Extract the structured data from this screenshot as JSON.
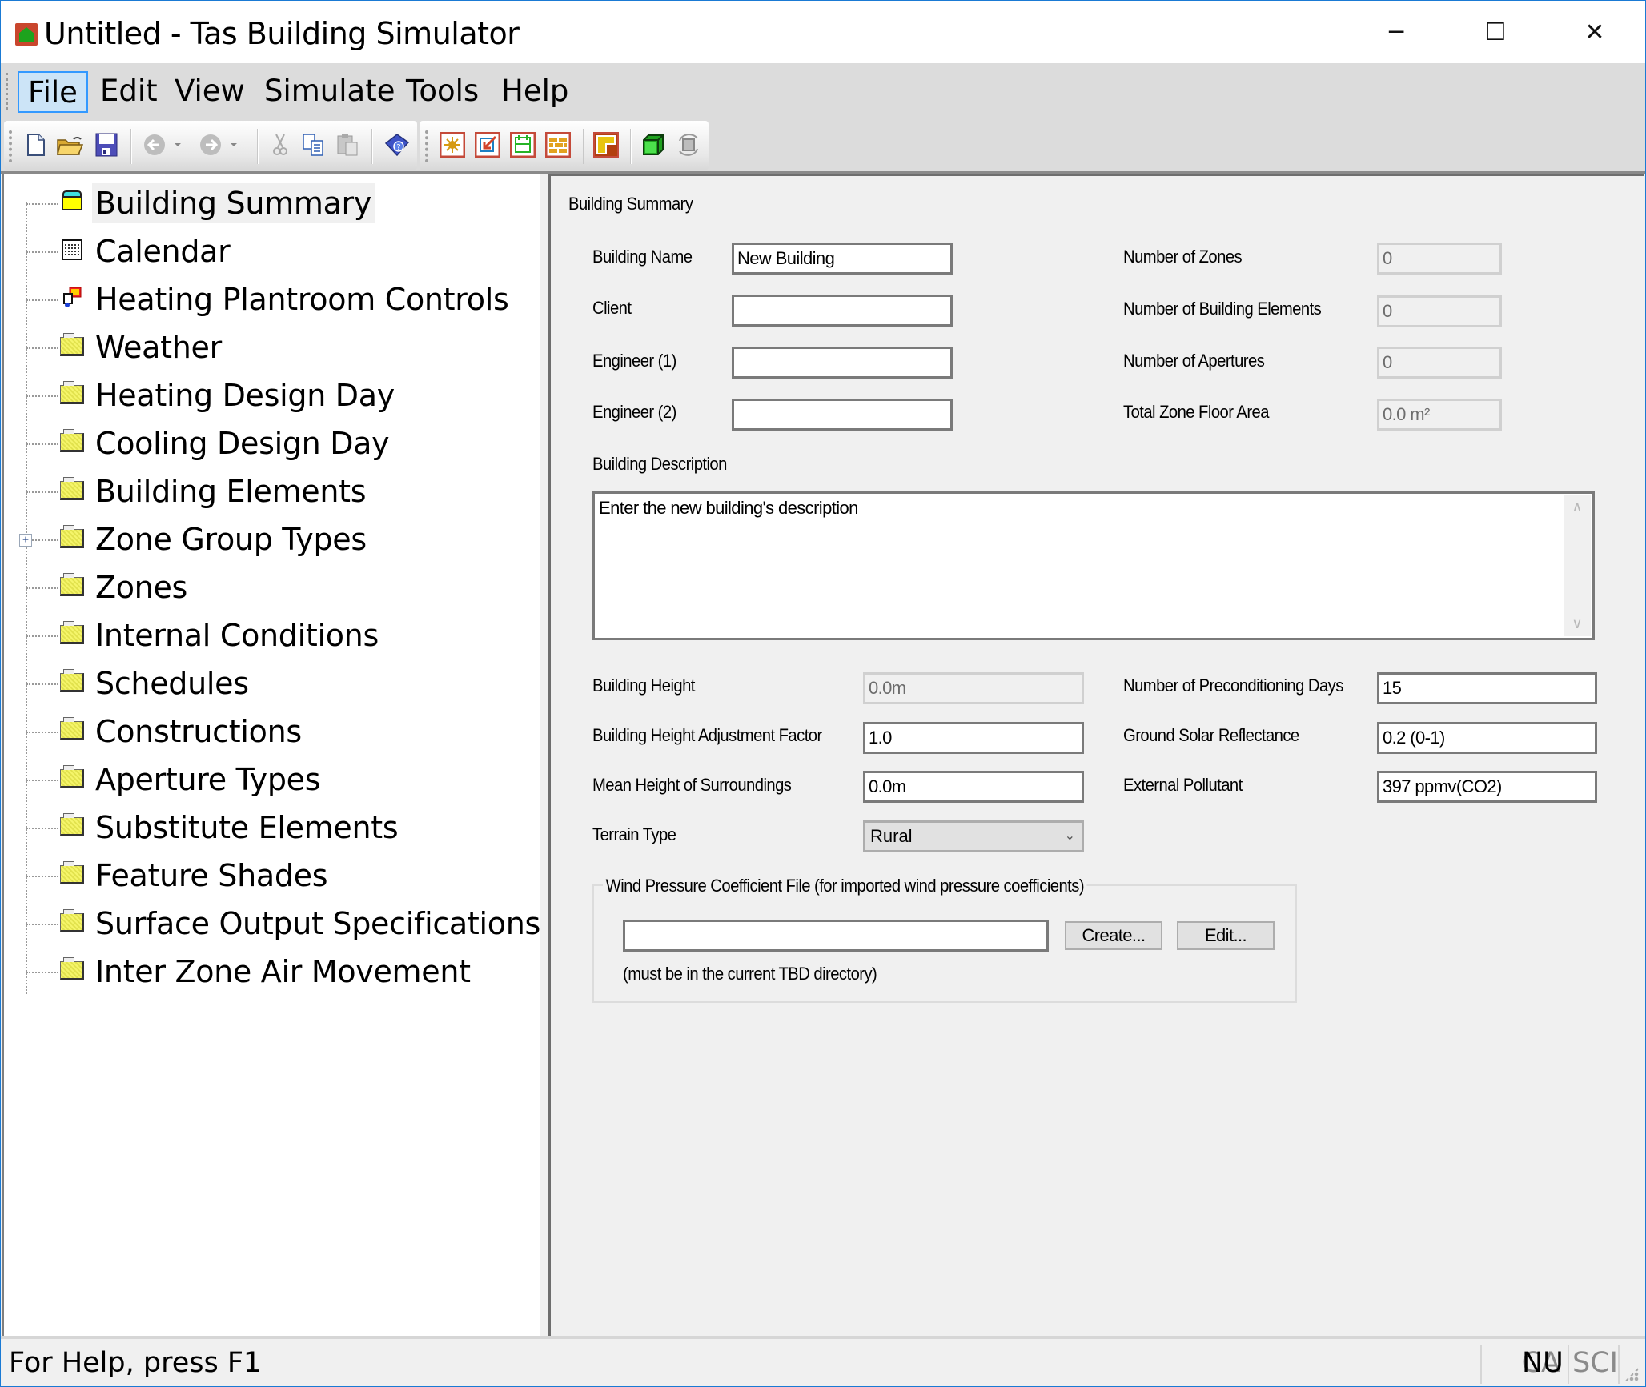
{
  "window": {
    "title": "Untitled - Tas Building Simulator",
    "controls": {
      "minimize": "─",
      "maximize": "☐",
      "close": "✕"
    }
  },
  "menu": [
    {
      "label": "File",
      "active": true
    },
    {
      "label": "Edit"
    },
    {
      "label": "View"
    },
    {
      "label": "Simulate"
    },
    {
      "label": "Tools"
    },
    {
      "label": "Help"
    }
  ],
  "toolbar": {
    "buttons": [
      {
        "icon": "new-file-icon",
        "enabled": true
      },
      {
        "icon": "open-folder-icon",
        "enabled": true
      },
      {
        "icon": "save-icon",
        "enabled": true
      },
      {
        "icon": "back-icon",
        "enabled": false
      },
      {
        "icon": "forward-icon",
        "enabled": false
      },
      {
        "icon": "cut-icon",
        "enabled": false
      },
      {
        "icon": "copy-icon",
        "enabled": true
      },
      {
        "icon": "paste-icon",
        "enabled": false
      },
      {
        "icon": "help-book-icon",
        "enabled": true
      },
      {
        "icon": "weather-sun-icon",
        "enabled": true
      },
      {
        "icon": "import-icon",
        "enabled": true
      },
      {
        "icon": "calendar-icon",
        "enabled": true
      },
      {
        "icon": "constructions-icon",
        "enabled": true
      },
      {
        "icon": "zone-shape-icon",
        "enabled": true
      },
      {
        "icon": "3d-model-icon",
        "enabled": true
      },
      {
        "icon": "rotate-view-icon",
        "enabled": false
      }
    ]
  },
  "tree": {
    "items": [
      {
        "label": "Building Summary",
        "icon": "building-summary-icon",
        "selected": true
      },
      {
        "label": "Calendar",
        "icon": "calendar-icon"
      },
      {
        "label": "Heating Plantroom Controls",
        "icon": "plantroom-controls-icon"
      },
      {
        "label": "Weather",
        "icon": "folder-icon"
      },
      {
        "label": "Heating Design Day",
        "icon": "folder-icon"
      },
      {
        "label": "Cooling Design Day",
        "icon": "folder-icon"
      },
      {
        "label": "Building Elements",
        "icon": "folder-icon"
      },
      {
        "label": "Zone Group Types",
        "icon": "folder-icon",
        "expandable": true,
        "expander": "+"
      },
      {
        "label": "Zones",
        "icon": "folder-icon"
      },
      {
        "label": "Internal Conditions",
        "icon": "folder-icon"
      },
      {
        "label": "Schedules",
        "icon": "folder-icon"
      },
      {
        "label": "Constructions",
        "icon": "folder-icon"
      },
      {
        "label": "Aperture Types",
        "icon": "folder-icon"
      },
      {
        "label": "Substitute Elements",
        "icon": "folder-icon"
      },
      {
        "label": "Feature Shades",
        "icon": "folder-icon"
      },
      {
        "label": "Surface Output Specifications",
        "icon": "folder-icon"
      },
      {
        "label": "Inter Zone Air Movement",
        "icon": "folder-icon"
      }
    ]
  },
  "form": {
    "heading": "Building Summary",
    "building_name": {
      "label": "Building Name",
      "value": "New Building"
    },
    "client": {
      "label": "Client",
      "value": ""
    },
    "engineer1": {
      "label": "Engineer (1)",
      "value": ""
    },
    "engineer2": {
      "label": "Engineer (2)",
      "value": ""
    },
    "num_zones": {
      "label": "Number of Zones",
      "value": "0"
    },
    "num_elements": {
      "label": "Number of Building Elements",
      "value": "0"
    },
    "num_apertures": {
      "label": "Number of Apertures",
      "value": "0"
    },
    "floor_area": {
      "label": "Total Zone Floor Area",
      "value": "0.0 m²"
    },
    "description": {
      "label": "Building Description",
      "value": "Enter the new building's description"
    },
    "building_height": {
      "label": "Building Height",
      "value": "0.0m"
    },
    "height_adjust": {
      "label": "Building Height Adjustment Factor",
      "value": "1.0"
    },
    "mean_height": {
      "label": "Mean Height of Surroundings",
      "value": "0.0m"
    },
    "terrain": {
      "label": "Terrain Type",
      "value": "Rural"
    },
    "precond_days": {
      "label": "Number of Preconditioning Days",
      "value": "15"
    },
    "ground_reflectance": {
      "label": "Ground Solar Reflectance",
      "value": "0.2 (0-1)"
    },
    "external_pollutant": {
      "label": "External Pollutant",
      "value": "397 ppmv(CO2)"
    },
    "wind": {
      "legend": "Wind Pressure Coefficient File (for imported wind pressure coefficients)",
      "value": "",
      "create_label": "Create...",
      "edit_label": "Edit...",
      "note": "(must be in the current TBD directory)"
    }
  },
  "status": {
    "text": "For Help, press F1",
    "indicators": [
      {
        "label": "CA",
        "active": false
      },
      {
        "label": "NU",
        "active": true
      },
      {
        "label": "SCI",
        "active": false
      }
    ]
  },
  "scroll_arrows": {
    "up": "∧",
    "down": "∨"
  },
  "select_chevron": "⌄"
}
